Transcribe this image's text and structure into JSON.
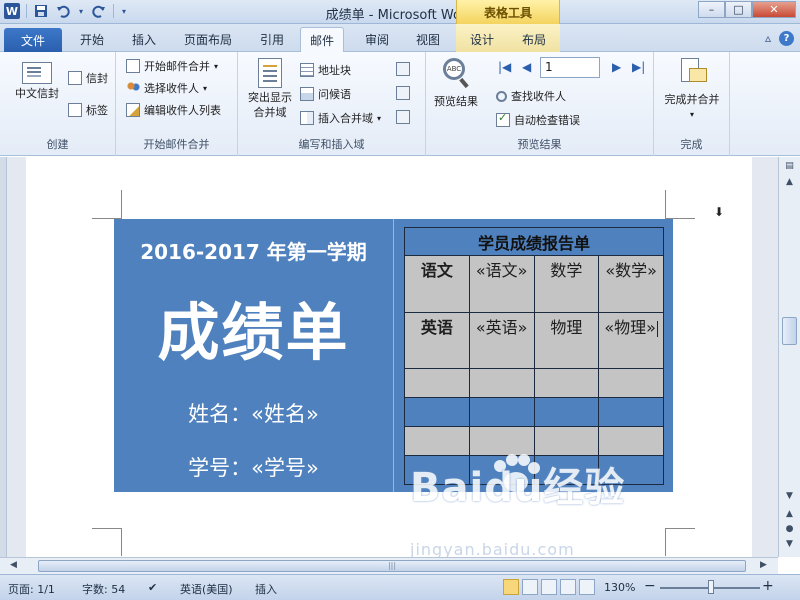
{
  "window": {
    "title": "成绩单 - Microsoft Word",
    "context_tab_group": "表格工具",
    "minimize": "–",
    "maximize": "□",
    "close": "✕"
  },
  "quick_access": {
    "app_icon": "W",
    "save_icon": "save-icon",
    "undo_icon": "undo-icon",
    "redo_icon": "redo-icon"
  },
  "tabs": [
    {
      "label": "文件"
    },
    {
      "label": "开始"
    },
    {
      "label": "插入"
    },
    {
      "label": "页面布局"
    },
    {
      "label": "引用"
    },
    {
      "label": "邮件"
    },
    {
      "label": "审阅"
    },
    {
      "label": "视图"
    },
    {
      "label": "设计"
    },
    {
      "label": "布局"
    }
  ],
  "ribbon": {
    "create": {
      "label": "创建",
      "chinese_envelope": "中文信封",
      "envelopes": "信封",
      "labels": "标签"
    },
    "start_merge": {
      "label": "开始邮件合并",
      "start_mail_merge": "开始邮件合并",
      "select_recipients": "选择收件人",
      "edit_recipient_list": "编辑收件人列表"
    },
    "write_insert": {
      "label": "编写和插入域",
      "highlight_fields_line1": "突出显示",
      "highlight_fields_line2": "合并域",
      "address_block": "地址块",
      "greeting_line": "问候语",
      "insert_merge_field": "插入合并域"
    },
    "preview": {
      "label": "预览结果",
      "preview_results": "预览结果",
      "record_number": "1",
      "find_recipient": "查找收件人",
      "auto_check_errors": "自动检查错误"
    },
    "finish": {
      "label": "完成",
      "finish_merge": "完成并合并"
    }
  },
  "document": {
    "term": "2016-2017 年第一学期",
    "title": "成绩单",
    "name_field": "姓名：«姓名»",
    "id_field": "学号：«学号»",
    "table": {
      "header": "学员成绩报告单",
      "rows": [
        [
          "语文",
          "«语文»",
          "数学",
          "«数学»"
        ],
        [
          "英语",
          "«英语»",
          "物理",
          "«物理»"
        ]
      ]
    },
    "watermark": "Baidu经验",
    "watermark_sub": "jingyan.baidu.com"
  },
  "statusbar": {
    "page": "页面: 1/1",
    "words": "字数: 54",
    "language": "英语(美国)",
    "mode": "插入",
    "zoom": "130%",
    "zoom_out": "−",
    "zoom_in": "+"
  },
  "colors": {
    "card_blue": "#4e81bd",
    "cell_gray": "#c4c4c4",
    "accent": "#2b579a"
  }
}
